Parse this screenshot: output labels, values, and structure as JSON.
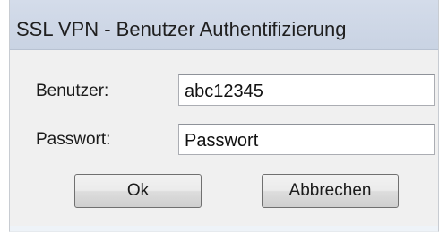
{
  "window": {
    "title": "SSL VPN - Benutzer Authentifizierung"
  },
  "form": {
    "user_label": "Benutzer:",
    "user_value": "abc12345",
    "password_label": "Passwort:",
    "password_value": "Passwort"
  },
  "buttons": {
    "ok_label": "Ok",
    "cancel_label": "Abbrechen"
  }
}
